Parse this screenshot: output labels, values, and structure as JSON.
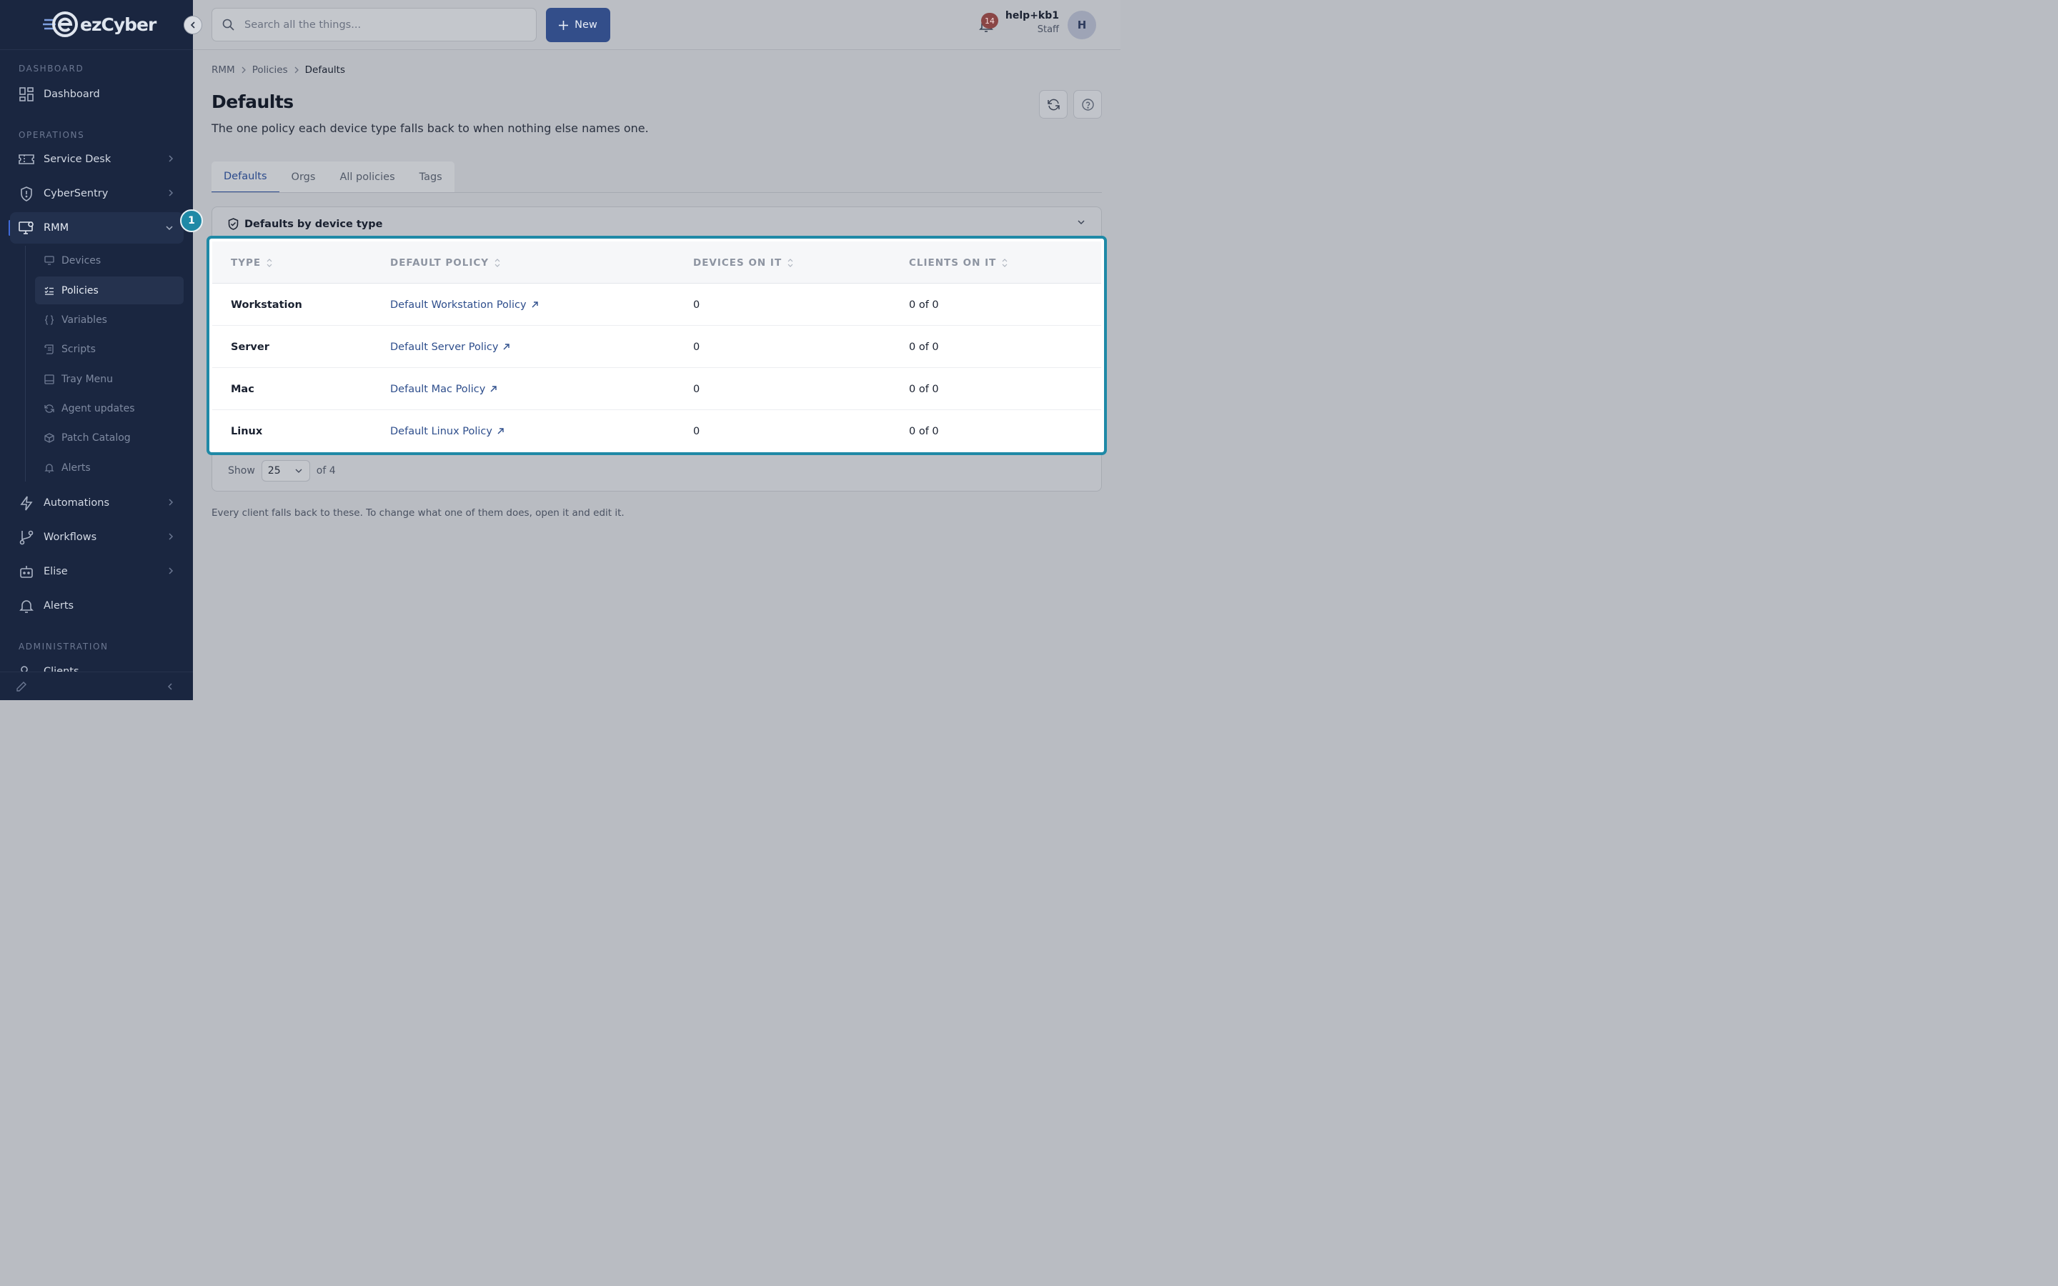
{
  "app": {
    "brand": "ezCyber"
  },
  "search": {
    "placeholder": "Search all the things..."
  },
  "topbar": {
    "new_label": "New",
    "notification_count": "14"
  },
  "user": {
    "name": "help+kb1",
    "role": "Staff",
    "initial": "H"
  },
  "sidebar": {
    "sections": {
      "dashboard": "DASHBOARD",
      "operations": "OPERATIONS",
      "administration": "ADMINISTRATION"
    },
    "items": {
      "dashboard": "Dashboard",
      "service_desk": "Service Desk",
      "cybersentry": "CyberSentry",
      "rmm": "RMM",
      "automations": "Automations",
      "workflows": "Workflows",
      "elise": "Elise",
      "alerts": "Alerts",
      "clients": "Clients"
    },
    "rmm_sub": {
      "devices": "Devices",
      "policies": "Policies",
      "variables": "Variables",
      "scripts": "Scripts",
      "tray_menu": "Tray Menu",
      "agent_updates": "Agent updates",
      "patch_catalog": "Patch Catalog",
      "alerts": "Alerts"
    }
  },
  "breadcrumb": {
    "root": "RMM",
    "parent": "Policies",
    "current": "Defaults"
  },
  "page": {
    "title": "Defaults",
    "subtitle": "The one policy each device type falls back to when nothing else names one.",
    "note": "Every client falls back to these. To change what one of them does, open it and edit it."
  },
  "tabs": {
    "defaults": "Defaults",
    "orgs": "Orgs",
    "all_policies": "All policies",
    "tags": "Tags"
  },
  "panel": {
    "title": "Defaults by device type",
    "show_label": "Show",
    "page_size": "25",
    "total_label": "of 4"
  },
  "table": {
    "headers": {
      "type": "TYPE",
      "policy": "DEFAULT POLICY",
      "devices": "DEVICES ON IT",
      "clients": "CLIENTS ON IT"
    },
    "rows": [
      {
        "type": "Workstation",
        "policy": "Default Workstation Policy",
        "devices": "0",
        "clients": "0 of 0"
      },
      {
        "type": "Server",
        "policy": "Default Server Policy",
        "devices": "0",
        "clients": "0 of 0"
      },
      {
        "type": "Mac",
        "policy": "Default Mac Policy",
        "devices": "0",
        "clients": "0 of 0"
      },
      {
        "type": "Linux",
        "policy": "Default Linux Policy",
        "devices": "0",
        "clients": "0 of 0"
      }
    ]
  },
  "callout": {
    "marker": "1"
  },
  "colors": {
    "sidebar": "#1a2640",
    "accent": "#334e8a",
    "highlight": "#1f89a6",
    "link": "#2e4e8c"
  }
}
